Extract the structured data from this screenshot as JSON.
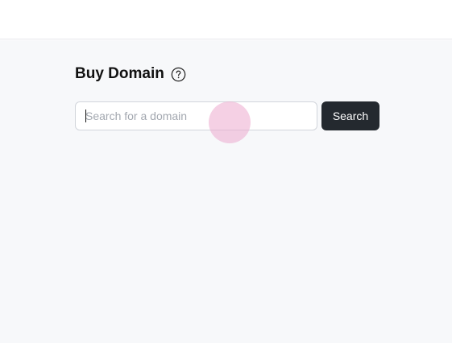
{
  "page": {
    "title": "Buy Domain",
    "help_icon": "question-circle-icon"
  },
  "search": {
    "placeholder": "Search for a domain",
    "value": "",
    "button_label": "Search"
  },
  "colors": {
    "page_background": "#f7f8fa",
    "button_background": "#24292f",
    "click_indicator": "#ecaacd"
  }
}
